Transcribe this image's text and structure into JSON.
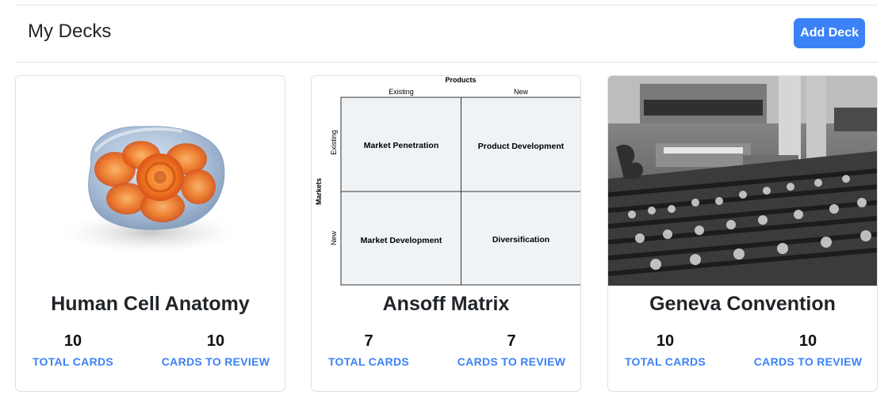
{
  "header": {
    "title": "My Decks",
    "add_button": "Add Deck"
  },
  "decks": [
    {
      "title": "Human Cell Anatomy",
      "total": "10",
      "total_label": "TOTAL CARDS",
      "review": "10",
      "review_label": "CARDS TO REVIEW"
    },
    {
      "title": "Ansoff Matrix",
      "total": "7",
      "total_label": "TOTAL CARDS",
      "review": "7",
      "review_label": "CARDS TO REVIEW"
    },
    {
      "title": "Geneva Convention",
      "total": "10",
      "total_label": "TOTAL CARDS",
      "review": "10",
      "review_label": "CARDS TO REVIEW"
    }
  ],
  "matrix": {
    "products": "Products",
    "existing_col": "Existing",
    "new_col": "New",
    "markets": "Markets",
    "existing_row": "Existing",
    "new_row": "New",
    "q1": "Market Penetration",
    "q2": "Product Development",
    "q3": "Market Development",
    "q4": "Diversification"
  },
  "colors": {
    "accent": "#3b82f6",
    "border": "#dee2e6"
  }
}
